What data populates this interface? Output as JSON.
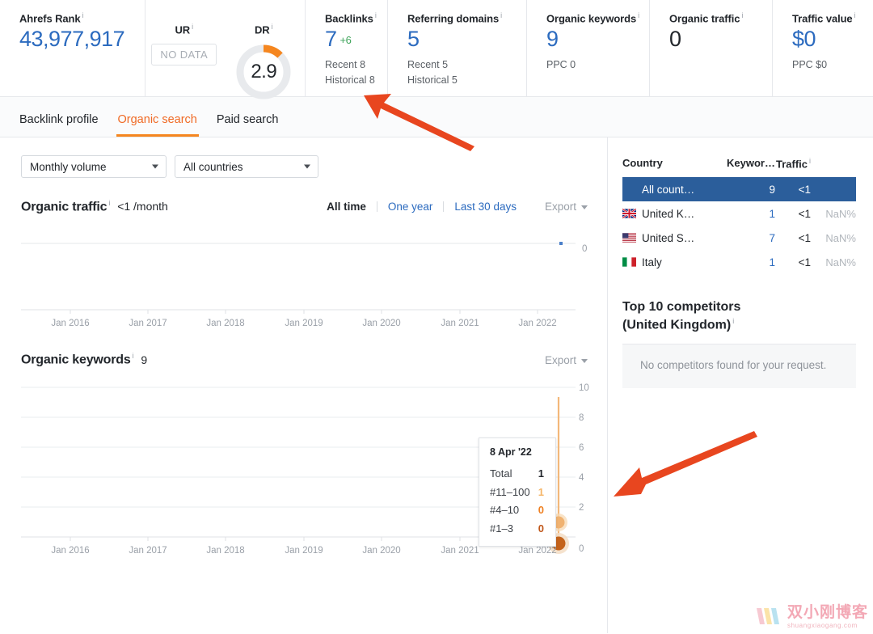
{
  "metrics": [
    {
      "label": "Ahrefs Rank",
      "value": "43,977,917",
      "value_color": "blue"
    },
    {
      "label_ur": "UR",
      "ur_badge": "NO DATA",
      "label_dr": "DR",
      "dr_value": "2.9"
    },
    {
      "label": "Backlinks",
      "value": "7",
      "delta": "+6",
      "sub1": "Recent 8",
      "sub2": "Historical 8"
    },
    {
      "label": "Referring domains",
      "value": "5",
      "sub1": "Recent 5",
      "sub2": "Historical 5"
    },
    {
      "label": "Organic keywords",
      "value": "9",
      "sub1": "PPC 0"
    },
    {
      "label": "Organic traffic",
      "value": "0",
      "value_color": "dark"
    },
    {
      "label": "Traffic value",
      "value": "$0",
      "sub1": "PPC $0"
    }
  ],
  "info_glyph": "i",
  "tabs": [
    {
      "label": "Backlink profile",
      "active": false
    },
    {
      "label": "Organic search",
      "active": true
    },
    {
      "label": "Paid search",
      "active": false
    }
  ],
  "filters": {
    "volume": "Monthly volume",
    "country": "All countries"
  },
  "organic_traffic": {
    "title": "Organic traffic",
    "subtitle": "<1 /month",
    "ranges": [
      "All time",
      "One year",
      "Last 30 days"
    ],
    "active_range": "All time",
    "export": "Export"
  },
  "organic_keywords": {
    "title": "Organic keywords",
    "subtitle": "9",
    "export": "Export"
  },
  "tooltip": {
    "date": "8 Apr '22",
    "rows": [
      {
        "key": "Total",
        "value": "1",
        "color": "#22262b"
      },
      {
        "key": "#11–100",
        "value": "1",
        "color": "#f5b567"
      },
      {
        "key": "#4–10",
        "value": "0",
        "color": "#ef8022"
      },
      {
        "key": "#1–3",
        "value": "0",
        "color": "#c0571a"
      }
    ]
  },
  "country_table": {
    "headers": [
      "Country",
      "Keywor…",
      "Traffic"
    ],
    "rows": [
      {
        "flag": "none",
        "country": "All count…",
        "keywords": "9",
        "traffic": "<1",
        "pct": "",
        "selected": true
      },
      {
        "flag": "uk",
        "country": "United K…",
        "keywords": "1",
        "traffic": "<1",
        "pct": "NaN%",
        "selected": false
      },
      {
        "flag": "us",
        "country": "United S…",
        "keywords": "7",
        "traffic": "<1",
        "pct": "NaN%",
        "selected": false
      },
      {
        "flag": "it",
        "country": "Italy",
        "keywords": "1",
        "traffic": "<1",
        "pct": "NaN%",
        "selected": false
      }
    ]
  },
  "competitors": {
    "title_line1": "Top 10 competitors",
    "title_line2": "(United Kingdom)",
    "empty_message": "No competitors found for your request."
  },
  "watermark": {
    "chinese": "双小刚博客",
    "english": "shuangxiaogang.com"
  },
  "colors": {
    "accent_orange": "#f5861f",
    "link_blue": "#2c6bbf",
    "selected_row_blue": "#2b5e9b",
    "arrow_red": "#e8461f",
    "green_delta": "#3fa45b"
  },
  "chart_data": [
    {
      "type": "line",
      "title": "Organic traffic",
      "xlabel": "",
      "ylabel": "",
      "x_ticks": [
        "Jan 2016",
        "Jan 2017",
        "Jan 2018",
        "Jan 2019",
        "Jan 2020",
        "Jan 2021",
        "Jan 2022"
      ],
      "y_ticks": [
        "0"
      ],
      "ylim": [
        0,
        0
      ],
      "grid": false,
      "series": [
        {
          "name": "Organic traffic",
          "color": "#2c6bbf",
          "values": [
            0,
            0,
            0,
            0,
            0,
            0,
            0,
            0
          ]
        }
      ],
      "markers": [
        {
          "x": "Feb 2022",
          "y": 0,
          "color": "#4a7fc9"
        }
      ],
      "note": "Flat line at zero across entire range with one small data point near Jan 2022"
    },
    {
      "type": "area",
      "title": "Organic keywords",
      "xlabel": "",
      "ylabel": "",
      "x_ticks": [
        "Jan 2016",
        "Jan 2017",
        "Jan 2018",
        "Jan 2019",
        "Jan 2020",
        "Jan 2021",
        "Jan 2022"
      ],
      "y_ticks": [
        "0",
        "2",
        "4",
        "6",
        "8",
        "10"
      ],
      "ylim": [
        0,
        10
      ],
      "grid": true,
      "hover_date": "8 Apr '22",
      "series": [
        {
          "name": "#1–3",
          "color": "#c0571a",
          "value_at_hover": 0
        },
        {
          "name": "#4–10",
          "color": "#ef8022",
          "value_at_hover": 0
        },
        {
          "name": "#11–100",
          "color": "#f5b567",
          "value_at_hover": 1
        },
        {
          "name": "Total",
          "color": "#22262b",
          "value_at_hover": 1
        }
      ],
      "note": "Flat at zero until Apr 2022 where total rises to 1"
    }
  ]
}
